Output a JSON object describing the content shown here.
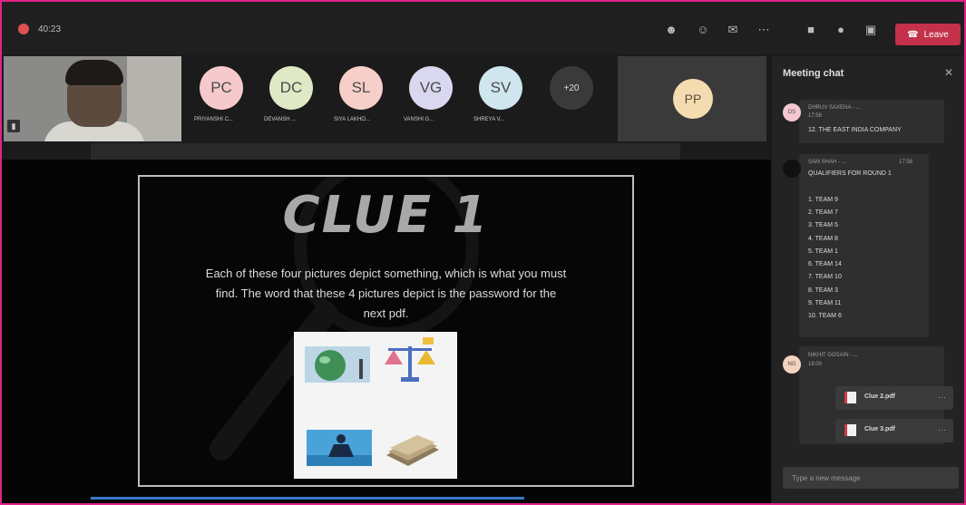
{
  "meeting": {
    "timer": "40:23"
  },
  "toolbar": {
    "icons": [
      "participants-icon",
      "reactions-icon",
      "chat-icon",
      "more-icon",
      "camera-icon",
      "mic-icon",
      "share-icon"
    ],
    "leave_label": "Leave"
  },
  "participants": [
    {
      "initials": "PC",
      "name": "PRIYANSHI C...",
      "color": "#f6c9cc"
    },
    {
      "initials": "DC",
      "name": "DEVANSH ...",
      "color": "#dfe9c5"
    },
    {
      "initials": "SL",
      "name": "SIYA LAKHO...",
      "color": "#f6cfc9"
    },
    {
      "initials": "VG",
      "name": "VANSHI G...",
      "color": "#d9d8f0"
    },
    {
      "initials": "SV",
      "name": "SHREYA V...",
      "color": "#cfe6ef"
    }
  ],
  "overflow_count": "+20",
  "pinned": {
    "initials": "PP",
    "color": "#f5dcb0"
  },
  "slide": {
    "title": "CLUE 1",
    "lines": [
      "Each of these four pictures depict something, which is what you must",
      "find. The word that these 4 pictures depict is the password for the",
      "next pdf."
    ]
  },
  "chat": {
    "title": "Meeting chat",
    "messages": [
      {
        "initials": "DS",
        "author": "DHRUV SAXENA - ...",
        "time": "17:56",
        "lines": [
          "12. THE EAST INDIA COMPANY"
        ]
      },
      {
        "initials": "",
        "author": "SAM SHAH - ...",
        "time": "17:58",
        "lines": [
          "QUALIFIERS FOR ROUND 1",
          "",
          "1. TEAM 9",
          "2. TEAM 7",
          "3. TEAM 5",
          "4. TEAM 8",
          "5. TEAM 1",
          "6. TEAM 14",
          "7. TEAM 10",
          "8. TEAM 3",
          "9. TEAM 11",
          "10. TEAM 6"
        ]
      },
      {
        "initials": "NG",
        "author": "NIKHIT GOSAIN - ...",
        "time": "18:00",
        "files": [
          "Clue 2.pdf",
          "Clue 3.pdf"
        ]
      }
    ],
    "compose_placeholder": "Type a new message"
  }
}
